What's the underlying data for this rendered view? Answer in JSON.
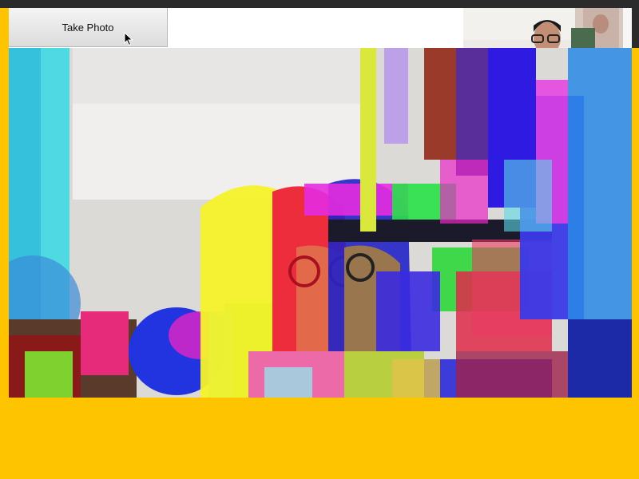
{
  "toolbar": {
    "take_photo_label": "Take Photo"
  },
  "colors": {
    "accent_yellow": "#ffc400",
    "toolbar_bg": "#ffffff",
    "frame_dark": "#2b2b2b"
  },
  "icons": {
    "cursor": "mouse-pointer-icon"
  }
}
